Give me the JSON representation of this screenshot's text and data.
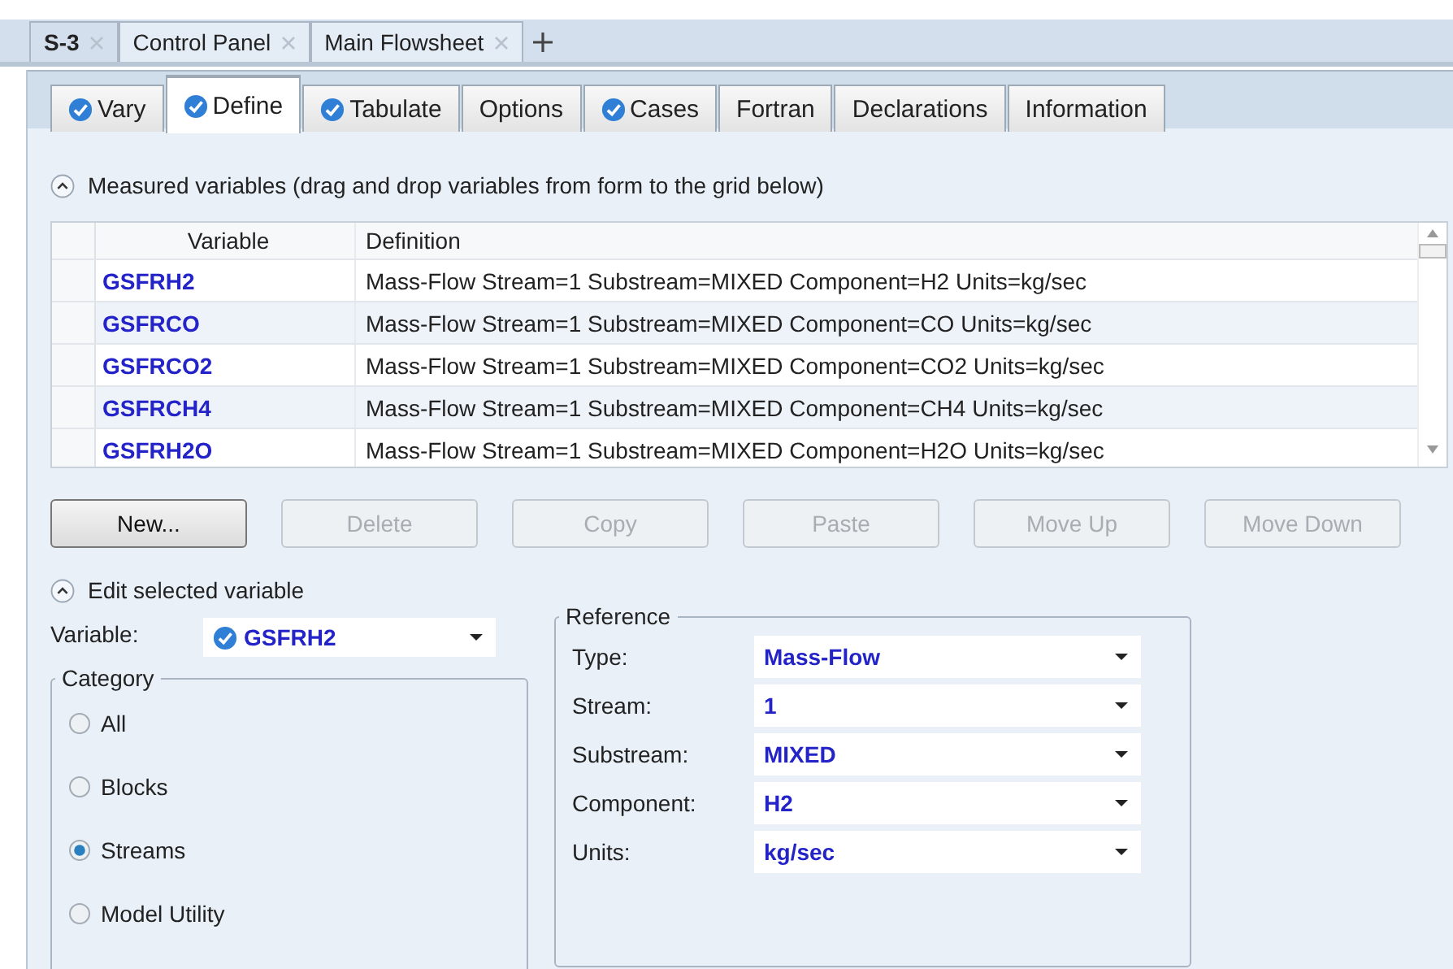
{
  "document_tabs": [
    {
      "label": "S-3",
      "selected": true
    },
    {
      "label": "Control Panel",
      "selected": false
    },
    {
      "label": "Main Flowsheet",
      "selected": false
    }
  ],
  "tabs": [
    {
      "label": "Vary",
      "complete": true,
      "selected": false
    },
    {
      "label": "Define",
      "complete": true,
      "selected": true
    },
    {
      "label": "Tabulate",
      "complete": true,
      "selected": false
    },
    {
      "label": "Options",
      "complete": false,
      "selected": false
    },
    {
      "label": "Cases",
      "complete": true,
      "selected": false
    },
    {
      "label": "Fortran",
      "complete": false,
      "selected": false
    },
    {
      "label": "Declarations",
      "complete": false,
      "selected": false
    },
    {
      "label": "Information",
      "complete": false,
      "selected": false
    }
  ],
  "measured_section": {
    "title": "Measured variables (drag and drop variables from form to the grid below)",
    "expanded": true
  },
  "table": {
    "columns": [
      "Variable",
      "Definition"
    ],
    "rows": [
      {
        "variable": "GSFRH2",
        "definition": "Mass-Flow Stream=1 Substream=MIXED Component=H2 Units=kg/sec"
      },
      {
        "variable": "GSFRCO",
        "definition": "Mass-Flow Stream=1 Substream=MIXED Component=CO Units=kg/sec"
      },
      {
        "variable": "GSFRCO2",
        "definition": "Mass-Flow Stream=1 Substream=MIXED Component=CO2 Units=kg/sec"
      },
      {
        "variable": "GSFRCH4",
        "definition": "Mass-Flow Stream=1 Substream=MIXED Component=CH4 Units=kg/sec"
      },
      {
        "variable": "GSFRH2O",
        "definition": "Mass-Flow Stream=1 Substream=MIXED Component=H2O Units=kg/sec"
      }
    ]
  },
  "buttons": [
    {
      "label": "New...",
      "disabled": false
    },
    {
      "label": "Delete",
      "disabled": true
    },
    {
      "label": "Copy",
      "disabled": true
    },
    {
      "label": "Paste",
      "disabled": true
    },
    {
      "label": "Move Up",
      "disabled": true
    },
    {
      "label": "Move Down",
      "disabled": true
    }
  ],
  "edit_section": {
    "title": "Edit selected variable",
    "expanded": true,
    "variable_label": "Variable:",
    "variable_value": "GSFRH2"
  },
  "category": {
    "title": "Category",
    "options": [
      {
        "label": "All",
        "selected": false
      },
      {
        "label": "Blocks",
        "selected": false
      },
      {
        "label": "Streams",
        "selected": true
      },
      {
        "label": "Model Utility",
        "selected": false
      }
    ]
  },
  "reference": {
    "title": "Reference",
    "fields": [
      {
        "label": "Type:",
        "value": "Mass-Flow"
      },
      {
        "label": "Stream:",
        "value": "1"
      },
      {
        "label": "Substream:",
        "value": "MIXED"
      },
      {
        "label": "Component:",
        "value": "H2"
      },
      {
        "label": "Units:",
        "value": "kg/sec"
      }
    ]
  }
}
